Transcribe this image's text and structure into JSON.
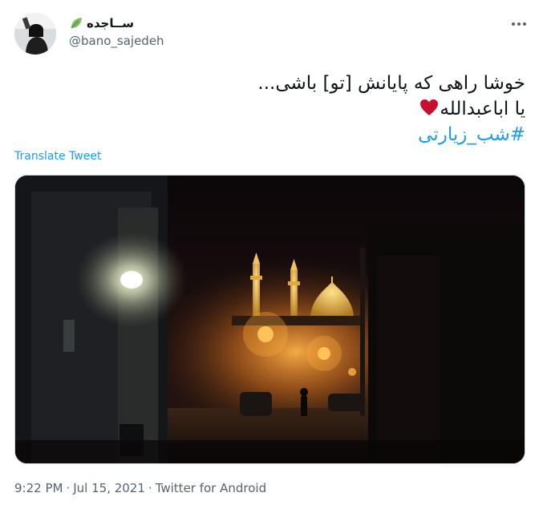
{
  "user": {
    "display_name": "ســاجده",
    "handle": "@bano_sajedeh",
    "verified_leaf_icon": "leaf-icon",
    "avatar_icon": "avatar"
  },
  "tweet": {
    "line1": "خوشا راهی که پایانش [تو] باشی...",
    "line2": "یا اباعبدالله",
    "heart_icon": "heart-icon",
    "hashtag": "#شب_زیارتی",
    "translate_label": "Translate Tweet"
  },
  "meta": {
    "time": "9:22 PM",
    "separator": "·",
    "date": "Jul 15, 2021",
    "source": "Twitter for Android"
  },
  "more_icon": "more-dots-icon",
  "colors": {
    "link": "#1d9bf0",
    "secondary_text": "#536471",
    "heart": "#c8102e"
  }
}
